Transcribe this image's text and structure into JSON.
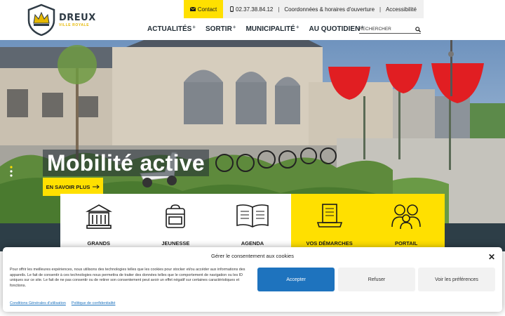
{
  "logo": {
    "name": "DREUX",
    "tagline": "VILLE ROYALE"
  },
  "topbar": {
    "contact_label": "Contact",
    "phone": "02.37.38.84.12",
    "hours_label": "Coordonnées & horaires d'ouverture",
    "accessibility_label": "Accessibilité"
  },
  "nav": {
    "items": [
      {
        "label": "Actualités",
        "plus": "+"
      },
      {
        "label": "Sortir",
        "plus": "+"
      },
      {
        "label": "Municipalité",
        "plus": "+"
      },
      {
        "label": "Au quotidien",
        "plus": "+"
      }
    ],
    "search_placeholder": "RECHERCHER"
  },
  "hero": {
    "title": "Mobilité active",
    "button_label": "EN SAVOIR PLUS",
    "colors": {
      "accent": "#ffe000",
      "dark": "#2d3e47"
    }
  },
  "quick_access": [
    {
      "label": "GRANDS",
      "icon": "building-icon"
    },
    {
      "label": "JEUNESSE",
      "icon": "backpack-icon"
    },
    {
      "label": "AGENDA",
      "icon": "open-book-icon"
    },
    {
      "label": "VOS DÉMARCHES",
      "icon": "laptop-document-icon"
    },
    {
      "label": "PORTAIL",
      "icon": "family-icon"
    }
  ],
  "cookie": {
    "title": "Gérer le consentement aux cookies",
    "text": "Pour offrir les meilleures expériences, nous utilisons des technologies telles que les cookies pour stocker et/ou accéder aux informations des appareils. Le fait de consentir à ces technologies nous permettra de traiter des données telles que le comportement de navigation ou les ID uniques sur ce site. Le fait de ne pas consentir ou de retirer son consentement peut avoir un effet négatif sur certaines caractéristiques et fonctions.",
    "accept_label": "Accepter",
    "refuse_label": "Refuser",
    "prefs_label": "Voir les préférences",
    "links": [
      "Conditions Générales d'utilisation",
      "Politique de confidentialité"
    ]
  }
}
